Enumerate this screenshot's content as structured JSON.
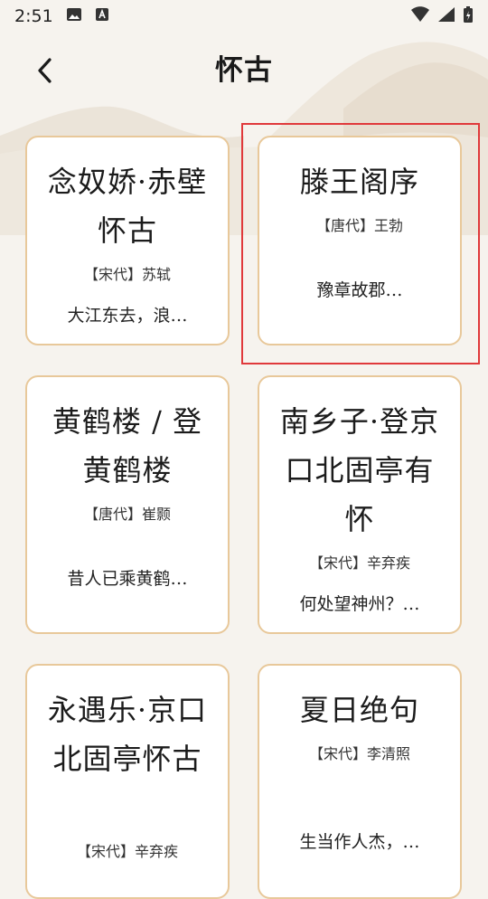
{
  "status_bar": {
    "time": "2:51"
  },
  "header": {
    "title": "怀古"
  },
  "cards": [
    {
      "title": "念奴娇·赤壁怀古",
      "author": "【宋代】苏轼",
      "excerpt": "大江东去，浪…"
    },
    {
      "title": "滕王阁序",
      "author": "【唐代】王勃",
      "excerpt": "豫章故郡…"
    },
    {
      "title": "黄鹤楼 / 登黄鹤楼",
      "author": "【唐代】崔颢",
      "excerpt": "昔人已乘黄鹤…"
    },
    {
      "title": "南乡子·登京口北固亭有怀",
      "author": "【宋代】辛弃疾",
      "excerpt": "何处望神州？…"
    },
    {
      "title": "永遇乐·京口北固亭怀古",
      "author": "【宋代】辛弃疾",
      "excerpt": ""
    },
    {
      "title": "夏日绝句",
      "author": "【宋代】李清照",
      "excerpt": "生当作人杰，…"
    }
  ]
}
